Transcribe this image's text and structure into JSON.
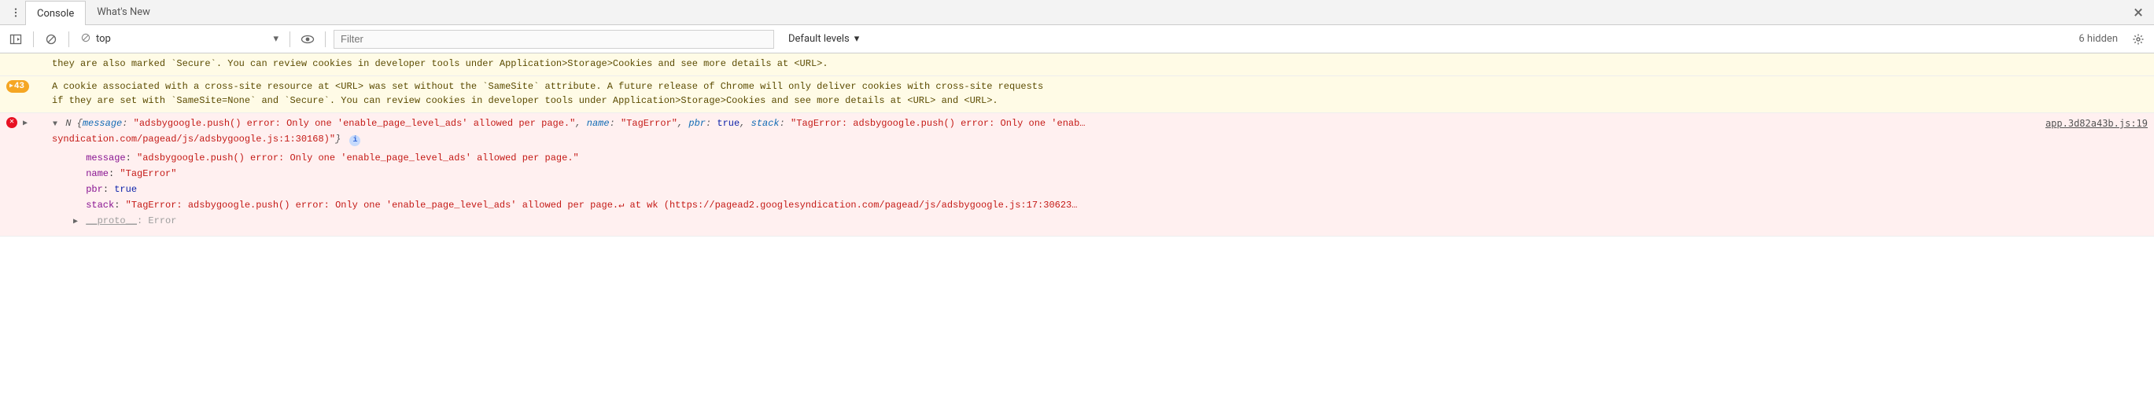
{
  "tabs": {
    "active": "Console",
    "inactive": "What's New"
  },
  "toolbar": {
    "context": "top",
    "filter_placeholder": "Filter",
    "levels": "Default levels",
    "hidden": "6 hidden"
  },
  "warn1": {
    "text_line1": "they are also marked `Secure`. You can review cookies in developer tools under Application>Storage>Cookies and see more details at <URL>."
  },
  "warn2": {
    "count": "43",
    "text_line1": "A cookie associated with a cross-site resource at <URL> was set without the `SameSite` attribute. A future release of Chrome will only deliver cookies with cross-site requests",
    "text_line2": "if they are set with `SameSite=None` and `Secure`. You can review cookies in developer tools under Application>Storage>Cookies and see more details at <URL> and <URL>."
  },
  "error": {
    "source": "app.3d82a43b.js:19",
    "head": {
      "name_label": "N",
      "message_key": "message",
      "message_val": "\"adsbygoogle.push() error: Only one 'enable_page_level_ads' allowed per page.\"",
      "name_key": "name",
      "name_val": "\"TagError\"",
      "pbr_key": "pbr",
      "pbr_val": "true",
      "stack_key": "stack",
      "stack_val_a": "\"TagError: adsbygoogle.push() error: Only one 'enab…",
      "stack_val_b": "syndication.com/pagead/js/adsbygoogle.js:1:30168)\""
    },
    "props": {
      "message_key": "message",
      "message_val": "\"adsbygoogle.push() error: Only one 'enable_page_level_ads' allowed per page.\"",
      "name_key": "name",
      "name_val": "\"TagError\"",
      "pbr_key": "pbr",
      "pbr_val": "true",
      "stack_key": "stack",
      "stack_val": "\"TagError: adsbygoogle.push() error: Only one 'enable_page_level_ads' allowed per page.↵    at wk (https://pagead2.googlesyndication.com/pagead/js/adsbygoogle.js:17:30623…",
      "proto_key": "__proto__",
      "proto_val": "Error"
    }
  }
}
